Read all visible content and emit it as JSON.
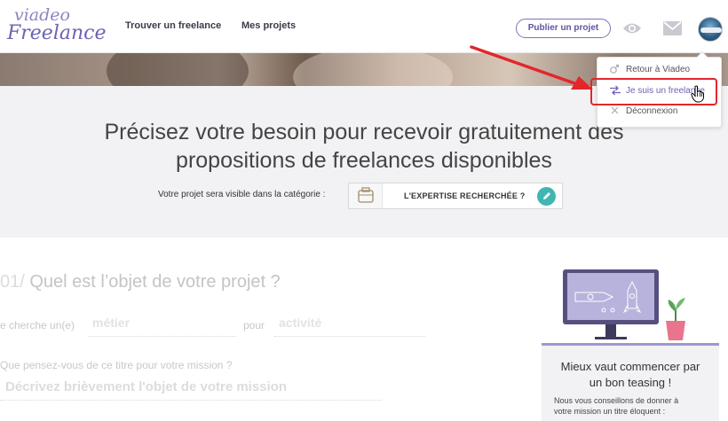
{
  "header": {
    "logo_top": "viadeo",
    "logo_bottom": "Freelance",
    "nav": [
      "Trouver un freelance",
      "Mes projets"
    ],
    "publish_label": "Publier un projet"
  },
  "hero": {
    "title_line1": "Précisez votre besoin pour recevoir gratuitement des",
    "title_line2": "propositions de freelances disponibles",
    "category_label": "Votre projet sera visible dans la catégorie :",
    "category_value": "L'EXPERTISE RECHERCHÉE ?"
  },
  "form": {
    "question_number": "01/",
    "question_title": "Quel est l’objet de votre projet ?",
    "search_prefix": "e cherche un(e)",
    "job_placeholder": "métier",
    "for_label": "pour",
    "activity_placeholder": "activité",
    "title_question": "Que pensez-vous de ce titre pour votre mission ?",
    "mission_placeholder": "Décrivez brièvement l'objet de votre mission"
  },
  "tip": {
    "title_line1": "Mieux vaut commencer par",
    "title_line2": "un bon teasing !",
    "text_line1": "Nous vous conseillons de donner à",
    "text_line2": "votre mission un titre éloquent :"
  },
  "menu": {
    "items": [
      "Retour à Viadeo",
      "Je suis un freelance",
      "Déconnexion"
    ],
    "highlighted_index": 1
  },
  "colors": {
    "brand": "#6b63b5",
    "accent_teal": "#3fb7b0",
    "annotation_red": "#e3262b"
  }
}
